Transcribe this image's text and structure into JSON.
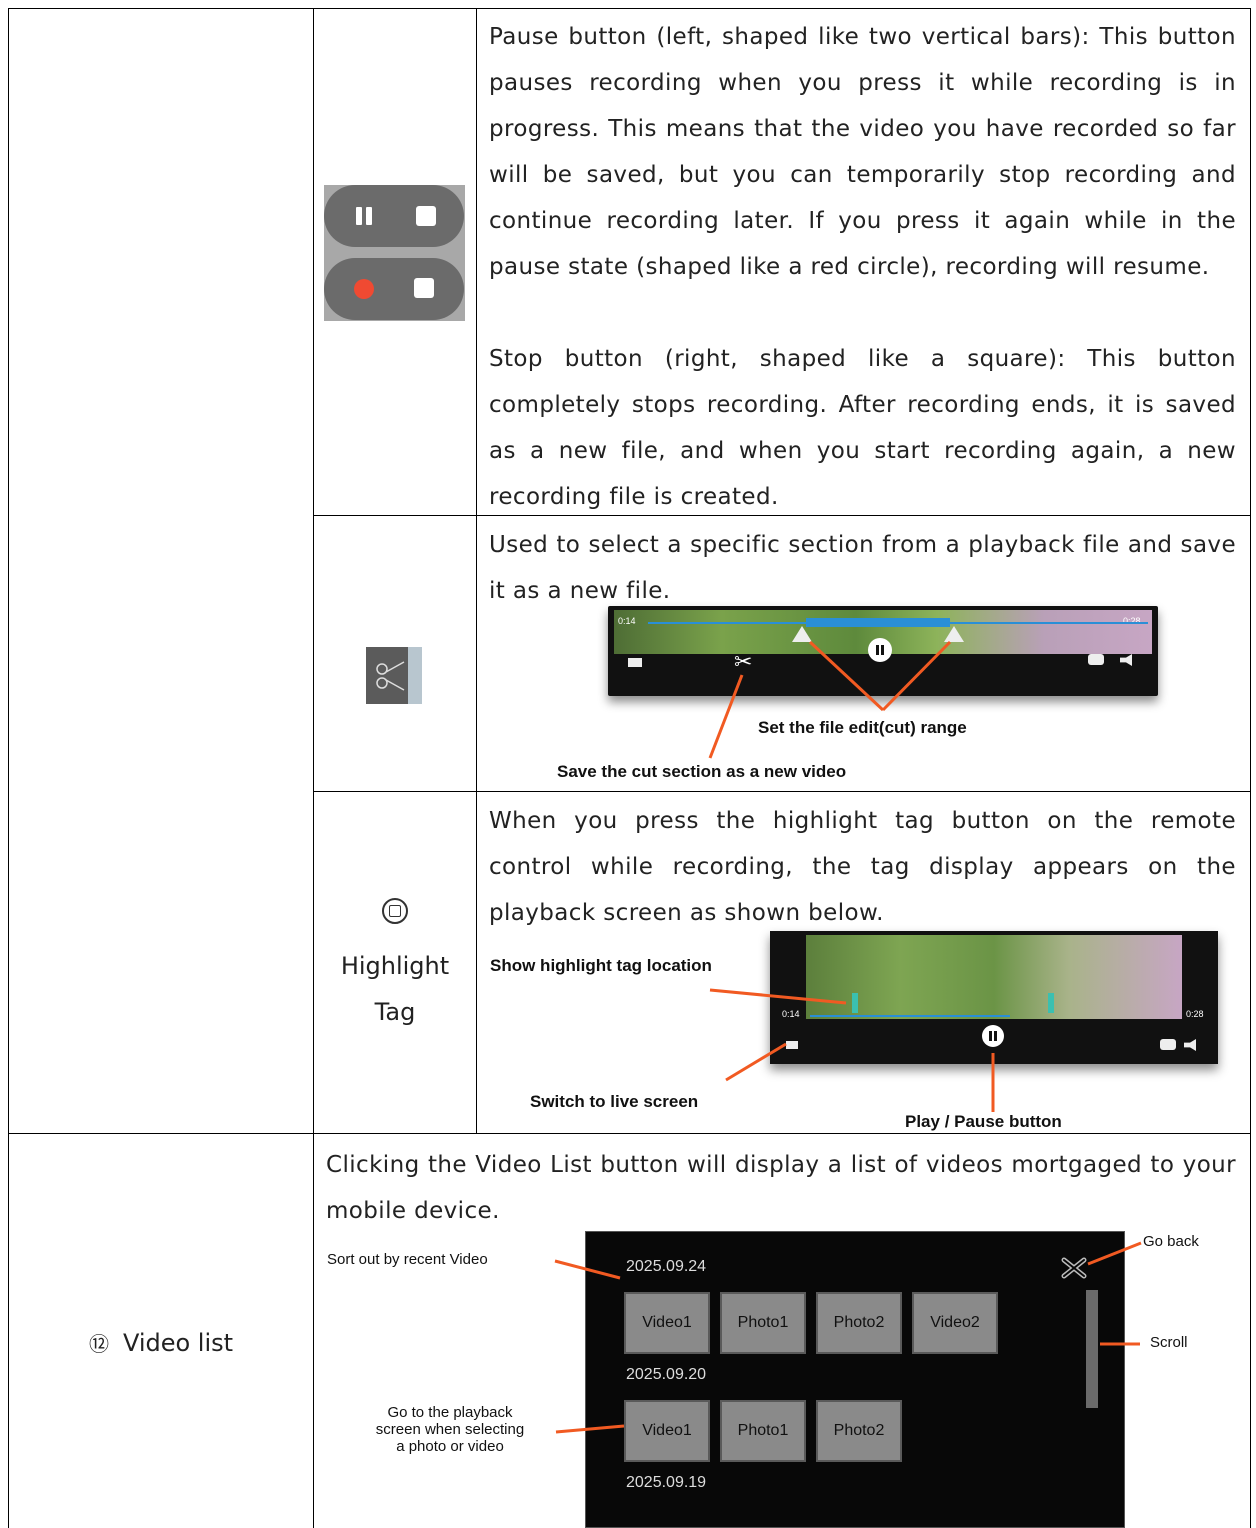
{
  "rows": {
    "pause_stop": {
      "pause_text": "Pause button (left, shaped like two vertical bars): This button pauses recording when you press it while recording is in progress. This means that the video you have recorded so far will be saved, but you can temporarily stop recording and continue recording later. If you press it again while in the pause state (shaped like a red circle), recording will resume.",
      "stop_text": "Stop button (right, shaped like a square): This button completely stops recording. After recording ends, it is saved as a new file, and when you start recording again, a new recording file is created."
    },
    "cut": {
      "text": "Used to select a specific section from a playback file and save it as a new file.",
      "time_start": "0:14",
      "time_end": "0:28",
      "label_range": "Set the file edit(cut) range",
      "label_save": "Save the cut section as a new video"
    },
    "highlight": {
      "label": "Highlight Tag",
      "label_line1": "Highlight",
      "label_line2": "Tag",
      "text": "When you press the highlight tag button on the remote control while recording, the tag display appears on the playback screen as shown below.",
      "time_start": "0:14",
      "time_end": "0:28",
      "label_tag": "Show highlight tag location",
      "label_live": "Switch to live screen",
      "label_play": "Play / Pause button"
    },
    "video_list": {
      "number": "⑫",
      "label": "Video list",
      "text": "Clicking the Video List button will display a list of videos mortgaged to your mobile device.",
      "ann_sort": "Sort out by recent Video",
      "ann_goto_1": "Go to the playback",
      "ann_goto_2": "screen when selecting",
      "ann_goto_3": "a photo or video",
      "ann_back": "Go back",
      "ann_scroll": "Scroll",
      "groups": [
        {
          "date": "2025.09.24",
          "items": [
            "Video1",
            "Photo1",
            "Photo2",
            "Video2"
          ]
        },
        {
          "date": "2025.09.20",
          "items": [
            "Video1",
            "Photo1",
            "Photo2"
          ]
        },
        {
          "date": "2025.09.19",
          "items": []
        }
      ]
    }
  },
  "colors": {
    "border": "#000000",
    "arrow": "#f15a22",
    "record_red": "#f04a32",
    "timeline_blue": "#2a8fd6"
  }
}
